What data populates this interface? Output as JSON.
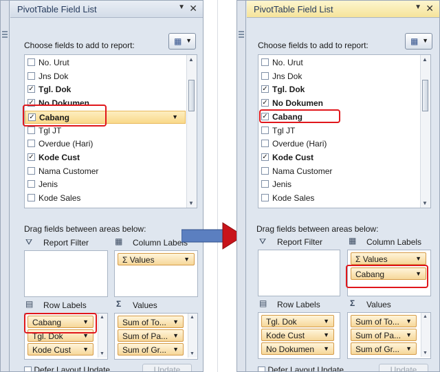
{
  "left": {
    "title": "PivotTable Field List",
    "choose_label": "Choose fields to add to report:",
    "fields": [
      {
        "label": "No. Urut",
        "checked": false,
        "bold": false
      },
      {
        "label": "Jns Dok",
        "checked": false,
        "bold": false
      },
      {
        "label": "Tgl. Dok",
        "checked": true,
        "bold": true
      },
      {
        "label": "No Dokumen",
        "checked": true,
        "bold": true
      },
      {
        "label": "Cabang",
        "checked": true,
        "bold": true
      },
      {
        "label": "Tgl JT",
        "checked": false,
        "bold": false
      },
      {
        "label": "Overdue (Hari)",
        "checked": false,
        "bold": false
      },
      {
        "label": "Kode Cust",
        "checked": true,
        "bold": true
      },
      {
        "label": "Nama Customer",
        "checked": false,
        "bold": false
      },
      {
        "label": "Jenis",
        "checked": false,
        "bold": false
      },
      {
        "label": "Kode Sales",
        "checked": false,
        "bold": false
      }
    ],
    "drag_label": "Drag fields between areas below:",
    "report_filter": "Report Filter",
    "column_labels": "Column Labels",
    "row_labels": "Row Labels",
    "values_label": "Values",
    "column_chips": [
      "Values"
    ],
    "row_chips": [
      "Cabang",
      "Tgl. Dok",
      "Kode Cust"
    ],
    "value_chips": [
      "Sum of To...",
      "Sum of Pa...",
      "Sum of Gr..."
    ],
    "defer": "Defer Layout Update",
    "update": "Update"
  },
  "right": {
    "title": "PivotTable Field List",
    "choose_label": "Choose fields to add to report:",
    "fields": [
      {
        "label": "No. Urut",
        "checked": false,
        "bold": false
      },
      {
        "label": "Jns Dok",
        "checked": false,
        "bold": false
      },
      {
        "label": "Tgl. Dok",
        "checked": true,
        "bold": true
      },
      {
        "label": "No Dokumen",
        "checked": true,
        "bold": true
      },
      {
        "label": "Cabang",
        "checked": true,
        "bold": true
      },
      {
        "label": "Tgl JT",
        "checked": false,
        "bold": false
      },
      {
        "label": "Overdue (Hari)",
        "checked": false,
        "bold": false
      },
      {
        "label": "Kode Cust",
        "checked": true,
        "bold": true
      },
      {
        "label": "Nama Customer",
        "checked": false,
        "bold": false
      },
      {
        "label": "Jenis",
        "checked": false,
        "bold": false
      },
      {
        "label": "Kode Sales",
        "checked": false,
        "bold": false
      }
    ],
    "drag_label": "Drag fields between areas below:",
    "report_filter": "Report Filter",
    "column_labels": "Column Labels",
    "row_labels": "Row Labels",
    "values_label": "Values",
    "column_chips": [
      "Values",
      "Cabang"
    ],
    "row_chips": [
      "Tgl. Dok",
      "Kode Cust",
      "No Dokumen"
    ],
    "value_chips": [
      "Sum of To...",
      "Sum of Pa...",
      "Sum of Gr..."
    ],
    "defer": "Defer Layout Update",
    "update": "Update"
  },
  "colors": {
    "highlight": "#e0161b",
    "arrow": "#c8131a",
    "chip": "#f6d79a"
  }
}
